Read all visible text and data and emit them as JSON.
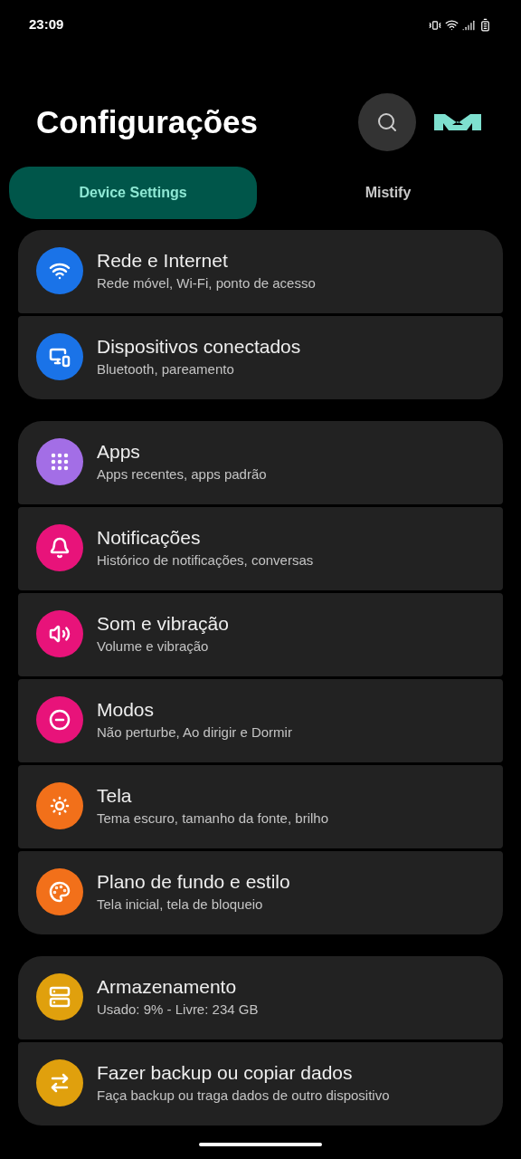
{
  "status_bar": {
    "time": "23:09"
  },
  "header": {
    "title": "Configurações"
  },
  "tabs": [
    {
      "label": "Device Settings",
      "selected": true
    },
    {
      "label": "Mistify",
      "selected": false
    }
  ],
  "groups": [
    {
      "items": [
        {
          "title": "Rede e Internet",
          "subtitle": "Rede móvel, Wi-Fi, ponto de acesso",
          "color": "#1a73e8"
        },
        {
          "title": "Dispositivos conectados",
          "subtitle": "Bluetooth, pareamento",
          "color": "#1a73e8"
        }
      ]
    },
    {
      "items": [
        {
          "title": "Apps",
          "subtitle": "Apps recentes, apps padrão",
          "color": "#a36ee6"
        },
        {
          "title": "Notificações",
          "subtitle": "Histórico de notificações, conversas",
          "color": "#e8137a"
        },
        {
          "title": "Som e vibração",
          "subtitle": "Volume e vibração",
          "color": "#e8137a"
        },
        {
          "title": "Modos",
          "subtitle": "Não perturbe, Ao dirigir e Dormir",
          "color": "#e8137a"
        },
        {
          "title": "Tela",
          "subtitle": "Tema escuro, tamanho da fonte, brilho",
          "color": "#f2701a"
        },
        {
          "title": "Plano de fundo e estilo",
          "subtitle": "Tela inicial, tela de bloqueio",
          "color": "#f2701a"
        }
      ]
    },
    {
      "items": [
        {
          "title": "Armazenamento",
          "subtitle": "Usado: 9% - Livre: 234 GB",
          "color": "#e0a00d"
        },
        {
          "title": "Fazer backup ou copiar dados",
          "subtitle": "Faça backup ou traga dados de outro dispositivo",
          "color": "#e0a00d"
        }
      ]
    }
  ]
}
